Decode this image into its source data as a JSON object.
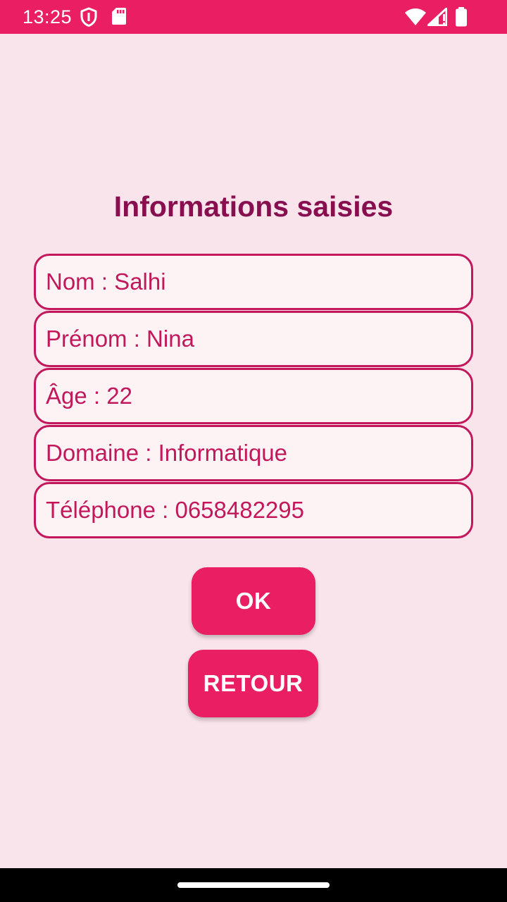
{
  "status_bar": {
    "time": "13:25",
    "icons": [
      "shield-icon",
      "sd-card-icon",
      "wifi-icon",
      "cell-signal-icon",
      "battery-icon"
    ],
    "background_color": "#e91e63"
  },
  "screen": {
    "title": "Informations saisies",
    "fields": [
      {
        "text": "Nom : Salhi"
      },
      {
        "text": "Prénom : Nina"
      },
      {
        "text": "Âge : 22"
      },
      {
        "text": "Domaine : Informatique"
      },
      {
        "text": "Téléphone : 0658482295"
      }
    ],
    "buttons": {
      "ok_label": "OK",
      "retour_label": "RETOUR"
    }
  },
  "colors": {
    "accent": "#e91e63",
    "title": "#880e4f",
    "field_border": "#c2185b",
    "background": "#f8e4ea"
  }
}
